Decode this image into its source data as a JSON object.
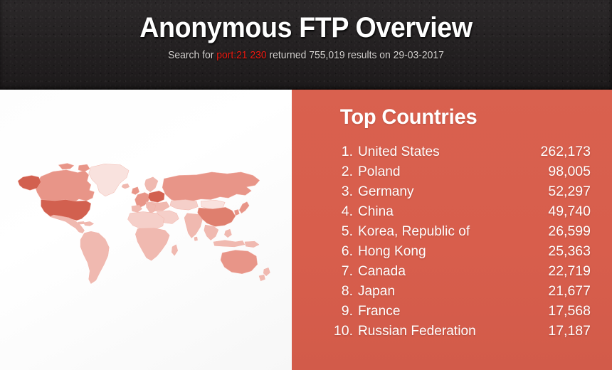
{
  "header": {
    "title": "Anonymous FTP Overview",
    "subtitle_prefix": "Search for ",
    "subtitle_query": "port:21 230",
    "subtitle_middle": " returned ",
    "result_count": "755,019",
    "subtitle_suffix": " results on ",
    "date": "29-03-2017",
    "background_color": "#232122",
    "query_color": "#ee1b11"
  },
  "stats": {
    "heading": "Top Countries",
    "panel_color": "#d9604f",
    "countries": [
      {
        "rank": "1.",
        "name": "United States",
        "count": "262,173"
      },
      {
        "rank": "2.",
        "name": "Poland",
        "count": "98,005"
      },
      {
        "rank": "3.",
        "name": "Germany",
        "count": "52,297"
      },
      {
        "rank": "4.",
        "name": "China",
        "count": "49,740"
      },
      {
        "rank": "5.",
        "name": "Korea, Republic of",
        "count": "26,599"
      },
      {
        "rank": "6.",
        "name": "Hong Kong",
        "count": "25,363"
      },
      {
        "rank": "7.",
        "name": "Canada",
        "count": "22,719"
      },
      {
        "rank": "8.",
        "name": "Japan",
        "count": "21,677"
      },
      {
        "rank": "9.",
        "name": "France",
        "count": "17,568"
      },
      {
        "rank": "10.",
        "name": "Russian Federation",
        "count": "17,187"
      }
    ]
  },
  "map": {
    "name": "world-choropleth-map",
    "background_color": "#ffffff",
    "border_color": "#f0aea3",
    "scale_colors": {
      "highest": "#d2604f",
      "high": "#df7f6e",
      "medium": "#e89588",
      "low": "#f0b9b0",
      "lower": "#f5cfc9",
      "lowest": "#f9e2de"
    },
    "regions": [
      {
        "name": "United States",
        "level": "highest"
      },
      {
        "name": "Poland",
        "level": "highest"
      },
      {
        "name": "Germany",
        "level": "highest"
      },
      {
        "name": "China",
        "level": "high"
      },
      {
        "name": "Alaska",
        "level": "highest"
      },
      {
        "name": "Canada",
        "level": "medium"
      },
      {
        "name": "Russian Federation",
        "level": "medium"
      },
      {
        "name": "France",
        "level": "medium"
      },
      {
        "name": "Japan",
        "level": "medium"
      },
      {
        "name": "Korea, Republic of",
        "level": "medium"
      },
      {
        "name": "Australia",
        "level": "medium"
      },
      {
        "name": "Brazil",
        "level": "low"
      },
      {
        "name": "India",
        "level": "low"
      },
      {
        "name": "Greenland",
        "level": "lowest"
      },
      {
        "name": "Africa",
        "level": "lower"
      },
      {
        "name": "Mongolia",
        "level": "lowest"
      },
      {
        "name": "Kazakhstan",
        "level": "lower"
      }
    ]
  }
}
